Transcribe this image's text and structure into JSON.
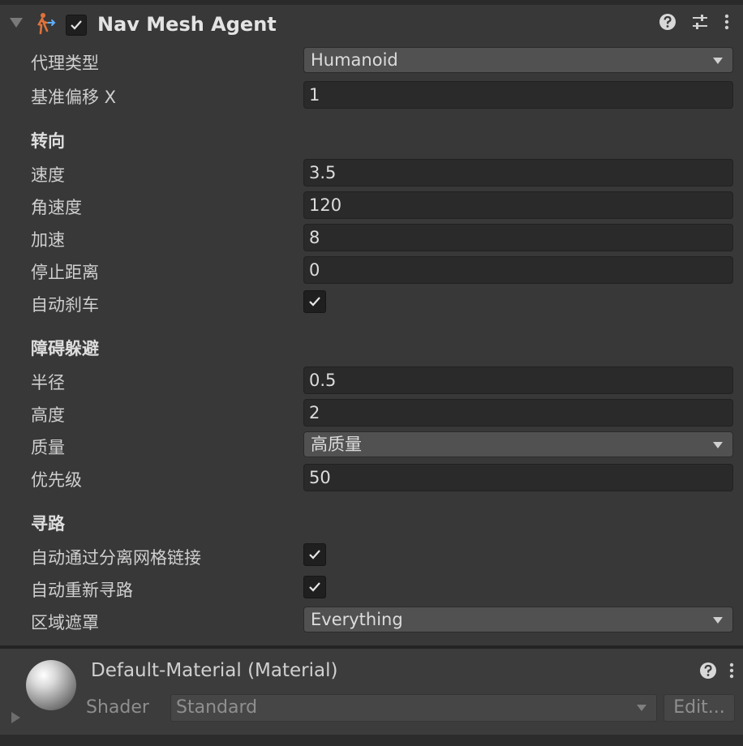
{
  "component": {
    "title": "Nav Mesh Agent",
    "enabled": true,
    "icons": [
      "help-icon",
      "preset-sliders-icon",
      "more-vertical-icon"
    ]
  },
  "fields": {
    "agent_type": {
      "label": "代理类型",
      "value": "Humanoid"
    },
    "base_offset": {
      "label": "基准偏移 X",
      "value": "1"
    }
  },
  "steering": {
    "heading": "转向",
    "speed": {
      "label": "速度",
      "value": "3.5"
    },
    "angular_speed": {
      "label": "角速度",
      "value": "120"
    },
    "acceleration": {
      "label": "加速",
      "value": "8"
    },
    "stopping_distance": {
      "label": "停止距离",
      "value": "0"
    },
    "auto_braking": {
      "label": "自动刹车",
      "checked": true
    }
  },
  "obstacle_avoidance": {
    "heading": "障碍躲避",
    "radius": {
      "label": "半径",
      "value": "0.5"
    },
    "height": {
      "label": "高度",
      "value": "2"
    },
    "quality": {
      "label": "质量",
      "value": "高质量"
    },
    "priority": {
      "label": "优先级",
      "value": "50"
    }
  },
  "pathfinding": {
    "heading": "寻路",
    "auto_traverse": {
      "label": "自动通过分离网格链接",
      "checked": true
    },
    "auto_repath": {
      "label": "自动重新寻路",
      "checked": true
    },
    "area_mask": {
      "label": "区域遮罩",
      "value": "Everything"
    }
  },
  "material": {
    "title": "Default-Material (Material)",
    "shader_label": "Shader",
    "shader_value": "Standard",
    "edit_label": "Edit..."
  },
  "colors": {
    "background": "#383838",
    "field": "#2a2a2a",
    "dropdown": "#515151",
    "agent_icon": "#e0723a"
  }
}
